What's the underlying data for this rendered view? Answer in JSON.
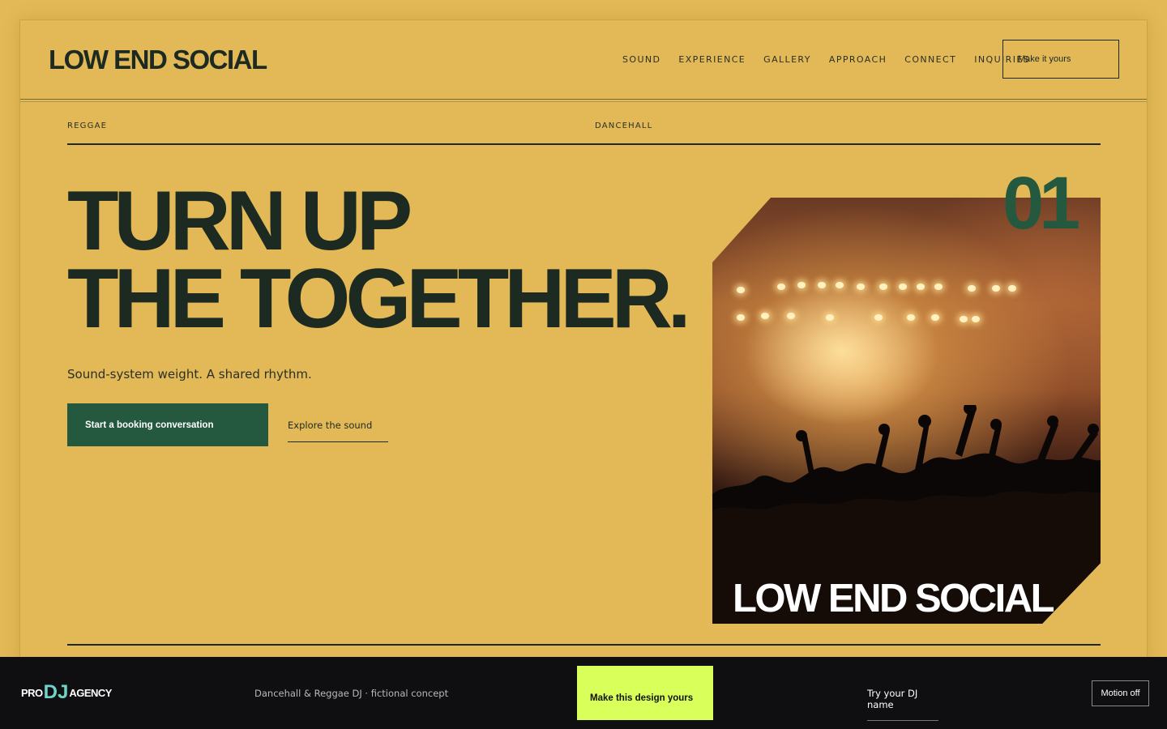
{
  "header": {
    "brand": "LOW END SOCIAL",
    "nav": [
      "SOUND",
      "EXPERIENCE",
      "GALLERY",
      "APPROACH",
      "CONNECT",
      "INQUIRIES"
    ],
    "cta": "Make it yours"
  },
  "hero": {
    "genres": [
      "REGGAE",
      "DANCEHALL"
    ],
    "headline_line1": "TURN UP",
    "headline_line2": "THE TOGETHER.",
    "subline": "Sound-system weight. A shared rhythm.",
    "primary_button": "Start a booking conversation",
    "secondary_link": "Explore the sound",
    "number": "01",
    "image_caption": "LOW END SOCIAL"
  },
  "footer": {
    "logo_left": "PRO",
    "logo_mid": "DJ",
    "logo_right": "AGENCY",
    "tagline": "Dancehall & Reggae DJ · fictional concept",
    "make_button": "Make this design yours",
    "try_link": "Try your DJ name",
    "motion_button": "Motion off"
  },
  "colors": {
    "background": "#e2b956",
    "ink": "#1c2a22",
    "accent_green": "#24583f",
    "footer_bg": "#0f0f12",
    "lime": "#d8ff5a"
  }
}
